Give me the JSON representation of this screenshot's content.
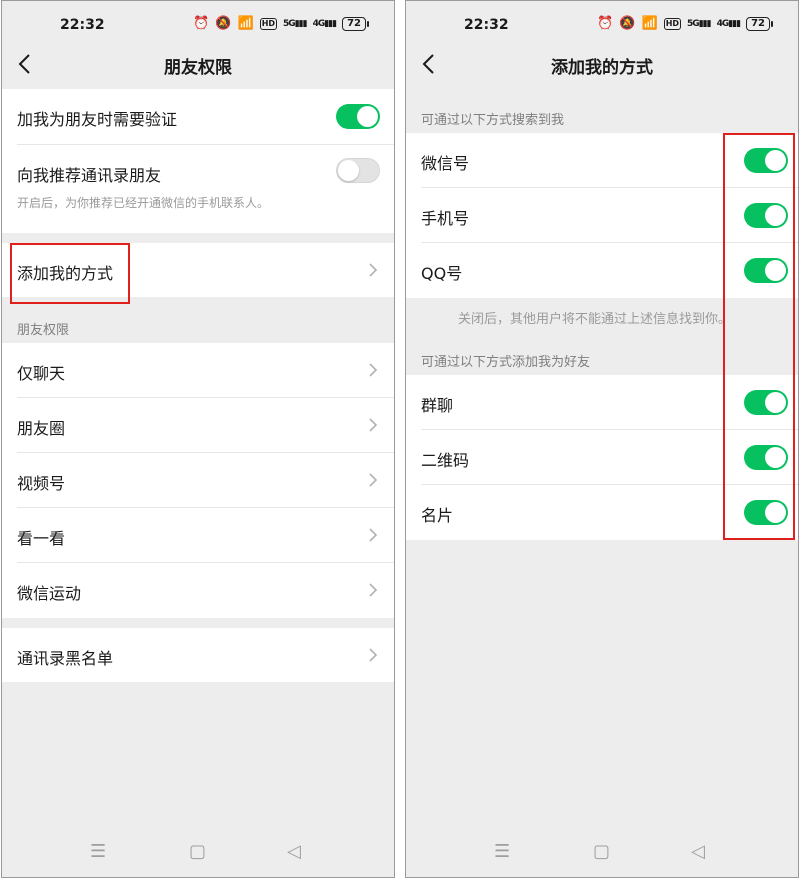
{
  "left_screen": {
    "status": {
      "time": "22:32",
      "battery": "72"
    },
    "title": "朋友权限",
    "require_verification": {
      "label": "加我为朋友时需要验证",
      "on": true
    },
    "recommend_contacts": {
      "label": "向我推荐通讯录朋友",
      "on": false,
      "hint": "开启后，为你推荐已经开通微信的手机联系人。"
    },
    "add_methods": {
      "label": "添加我的方式"
    },
    "permission_section": "朋友权限",
    "permission_items": [
      "仅聊天",
      "朋友圈",
      "视频号",
      "看一看",
      "微信运动"
    ],
    "blacklist": "通讯录黑名单"
  },
  "right_screen": {
    "status": {
      "time": "22:32",
      "battery": "72"
    },
    "title": "添加我的方式",
    "search_section": "可通过以下方式搜索到我",
    "search_items": [
      {
        "label": "微信号",
        "on": true
      },
      {
        "label": "手机号",
        "on": true
      },
      {
        "label": "QQ号",
        "on": true
      }
    ],
    "search_note": "关闭后，其他用户将不能通过上述信息找到你。",
    "add_section": "可通过以下方式添加我为好友",
    "add_items": [
      {
        "label": "群聊",
        "on": true
      },
      {
        "label": "二维码",
        "on": true
      },
      {
        "label": "名片",
        "on": true
      }
    ]
  },
  "system_nav": {
    "menu_icon": "menu-icon",
    "home_icon": "home-icon",
    "back_icon": "back-triangle-icon"
  },
  "colors": {
    "accent_green": "#07c160",
    "highlight_red": "#e0201c",
    "background": "#ededed"
  }
}
